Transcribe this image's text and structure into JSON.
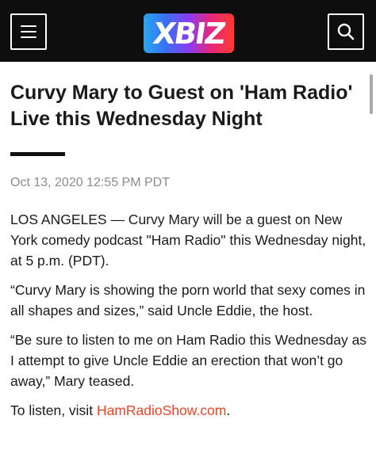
{
  "header": {
    "logo_text": "XBIZ",
    "brand_gradient": [
      "#27a6f0",
      "#8a3cf0",
      "#e8257a",
      "#ff3c2e"
    ],
    "background": "#0e0e0e",
    "menu_icon": "hamburger-menu-icon",
    "search_icon": "search-icon"
  },
  "article": {
    "title": "Curvy Mary to Guest on 'Ham Radio' Live this Wednesday Night",
    "date": "Oct 13, 2020 12:55 PM PDT",
    "paragraphs": [
      "LOS ANGELES — Curvy Mary will be a guest on New York comedy podcast \"Ham Radio\" this Wednesday night, at 5 p.m. (PDT).",
      "“Curvy Mary is showing the porn world that sexy comes in all shapes and sizes,” said Uncle Eddie, the host.",
      "“Be sure to listen to me on Ham Radio this Wednesday as I attempt to give Uncle Eddie an erection that won’t go away,” Mary teased."
    ],
    "listen_prefix": "To listen, visit ",
    "listen_link": "HamRadioShow.com",
    "listen_suffix": ".",
    "link_color": "#e8462b"
  }
}
